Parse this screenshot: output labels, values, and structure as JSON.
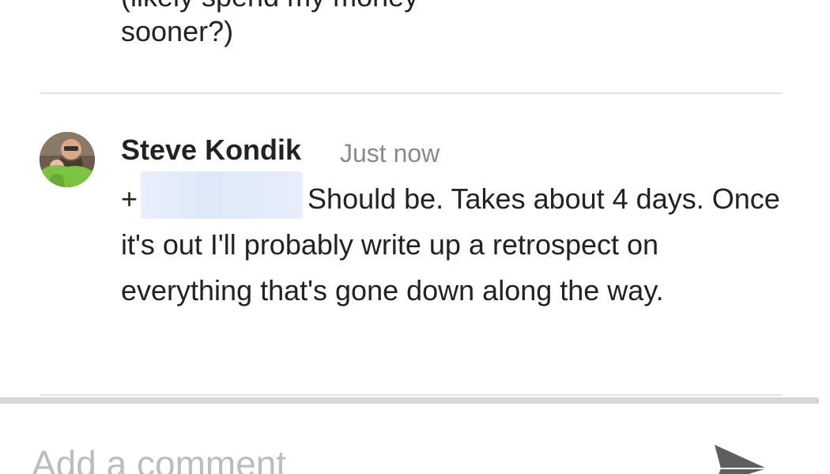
{
  "previous_comment": {
    "text_cut": "(likely spend my money",
    "text": "sooner?)"
  },
  "comment": {
    "author": "Steve Kondik",
    "time": "Just now",
    "mention_prefix": "+",
    "body_first_line": "Should be. Takes about 4 days.",
    "body_rest": "Once it's out I'll probably write up a retrospect on everything that's gone down along the way."
  },
  "composer": {
    "placeholder": "Add a comment"
  },
  "icons": {
    "send": "send-icon",
    "avatar": "avatar"
  }
}
